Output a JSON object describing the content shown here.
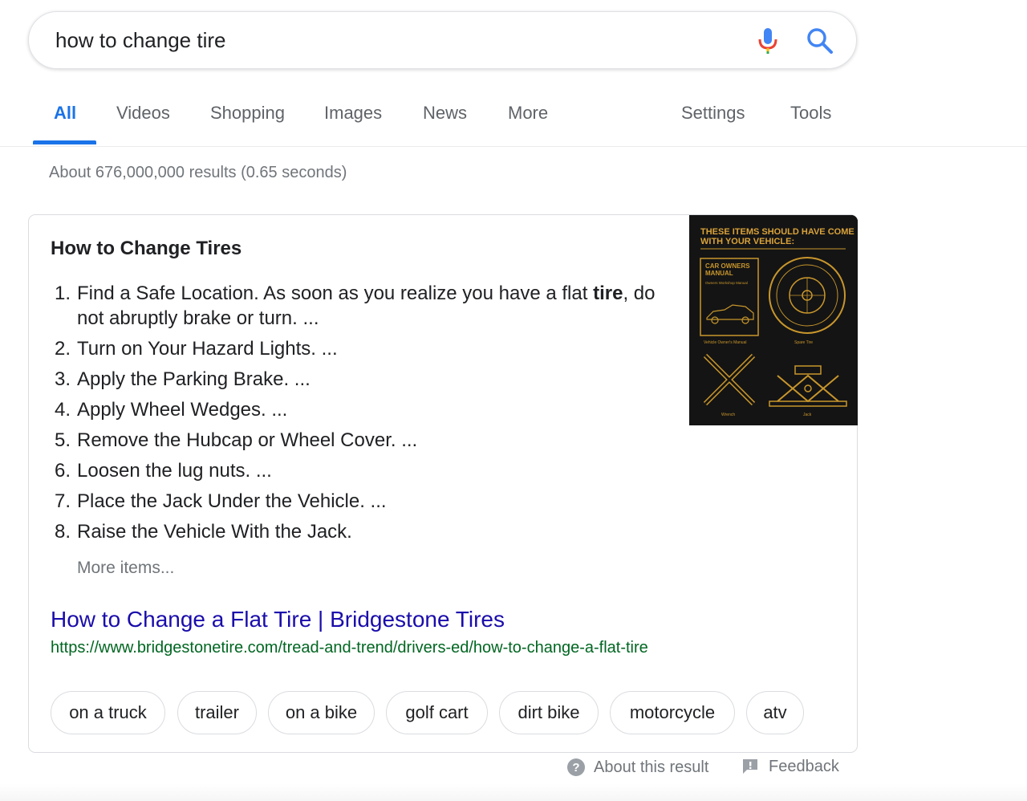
{
  "search": {
    "query": "how to change tire",
    "mic_icon": "mic-icon",
    "search_icon": "search-icon",
    "colors": {
      "blue": "#4285f4",
      "red": "#ea4335",
      "yellow": "#fbbc05",
      "green": "#34a853"
    }
  },
  "tabs": [
    {
      "label": "All",
      "active": true
    },
    {
      "label": "Videos"
    },
    {
      "label": "Shopping"
    },
    {
      "label": "Images"
    },
    {
      "label": "News"
    },
    {
      "label": "More"
    },
    {
      "label": "Settings"
    },
    {
      "label": "Tools"
    }
  ],
  "result_stats": "About 676,000,000 results (0.65 seconds)",
  "snippet": {
    "title": "How to Change Tires",
    "steps": [
      {
        "num": "1.",
        "text_a": "Find a Safe Location. As soon as you realize you have a flat ",
        "bold": "tire",
        "text_b": ", do not abruptly brake or turn. ..."
      },
      {
        "num": "2.",
        "text": "Turn on Your Hazard Lights. ..."
      },
      {
        "num": "3.",
        "text": "Apply the Parking Brake. ..."
      },
      {
        "num": "4.",
        "text": "Apply Wheel Wedges. ..."
      },
      {
        "num": "5.",
        "text": "Remove the Hubcap or Wheel Cover. ..."
      },
      {
        "num": "6.",
        "text": "Loosen the lug nuts. ..."
      },
      {
        "num": "7.",
        "text": "Place the Jack Under the Vehicle. ..."
      },
      {
        "num": "8.",
        "text": "Raise the Vehicle With the Jack."
      }
    ],
    "more_items": "More items...",
    "link_title": "How to Change a Flat Tire | Bridgestone Tires",
    "link_url": "https://www.bridgestonetire.com/tread-and-trend/drivers-ed/how-to-change-a-flat-tire",
    "image": {
      "heading_line1": "THESE ITEMS SHOULD HAVE COME",
      "heading_line2": "WITH YOUR VEHICLE:",
      "manual_line1": "CAR OWNERS",
      "manual_line2": "MANUAL",
      "manual_sub": "Owners Workshop Manual",
      "label_manual": "Vehicle Owner's Manual",
      "label_tire": "Spare Tire",
      "label_wrench": "Wrench",
      "label_jack": "Jack",
      "accent_color": "#c8962c"
    }
  },
  "chips": [
    "on a truck",
    "trailer",
    "on a bike",
    "golf cart",
    "dirt bike",
    "motorcycle",
    "atv"
  ],
  "footer": {
    "about": "About this result",
    "feedback": "Feedback",
    "about_icon": "help-circle-icon",
    "feedback_icon": "feedback-icon"
  }
}
